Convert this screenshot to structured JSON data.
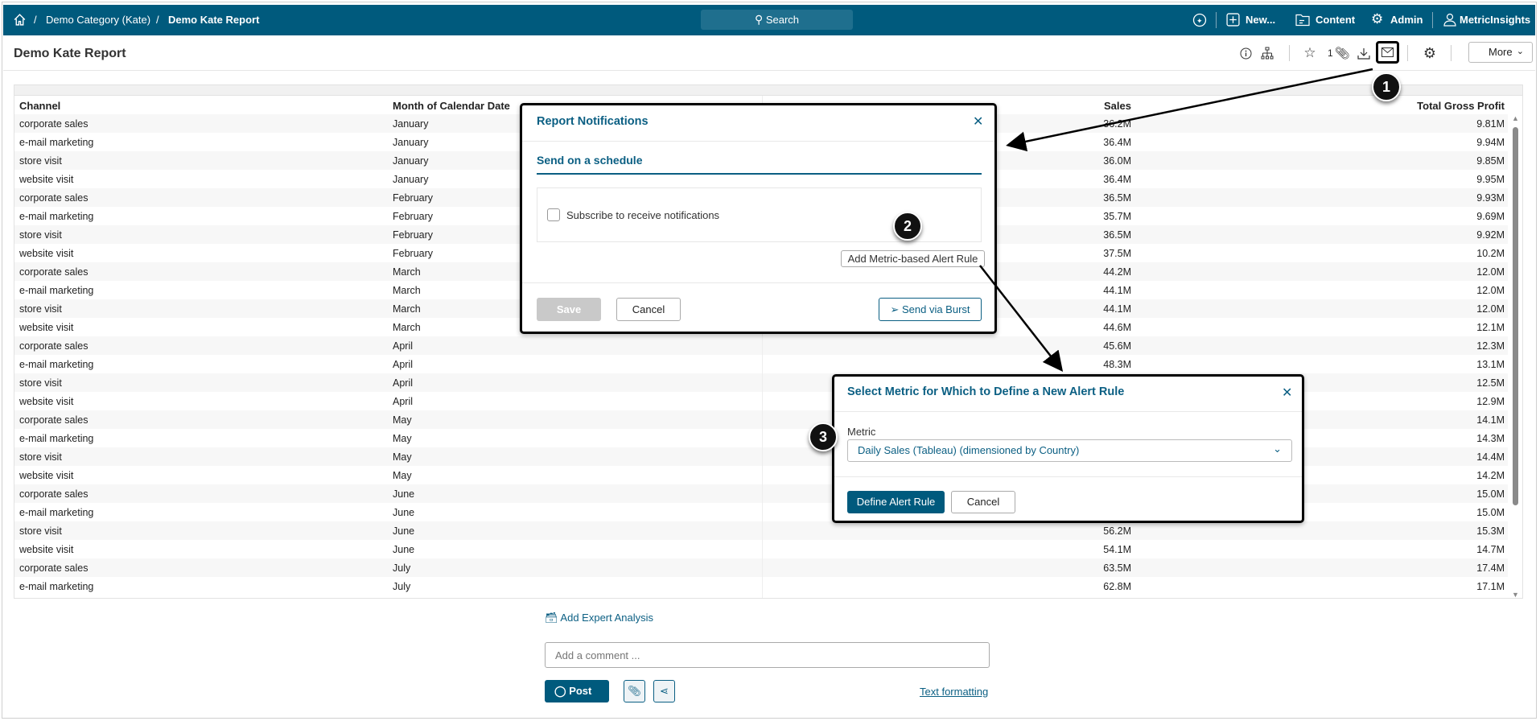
{
  "nav": {
    "breadcrumb": [
      "Demo Category (Kate)",
      "Demo Kate Report"
    ],
    "search_label": "Search",
    "new_label": "New...",
    "content_label": "Content",
    "admin_label": "Admin",
    "user_label": "MetricInsights"
  },
  "header": {
    "title": "Demo Kate Report",
    "favorites_count": "1",
    "more_label": "More"
  },
  "table": {
    "columns": [
      "Channel",
      "Month of Calendar Date",
      "Sales",
      "Total Gross Profit"
    ],
    "rows": [
      [
        "corporate sales",
        "January",
        "36.2M",
        "9.81M"
      ],
      [
        "e-mail marketing",
        "January",
        "36.4M",
        "9.94M"
      ],
      [
        "store visit",
        "January",
        "36.0M",
        "9.85M"
      ],
      [
        "website visit",
        "January",
        "36.4M",
        "9.95M"
      ],
      [
        "corporate sales",
        "February",
        "36.5M",
        "9.93M"
      ],
      [
        "e-mail marketing",
        "February",
        "35.7M",
        "9.69M"
      ],
      [
        "store visit",
        "February",
        "36.5M",
        "9.92M"
      ],
      [
        "website visit",
        "February",
        "37.5M",
        "10.2M"
      ],
      [
        "corporate sales",
        "March",
        "44.2M",
        "12.0M"
      ],
      [
        "e-mail marketing",
        "March",
        "44.1M",
        "12.0M"
      ],
      [
        "store visit",
        "March",
        "44.1M",
        "12.0M"
      ],
      [
        "website visit",
        "March",
        "44.6M",
        "12.1M"
      ],
      [
        "corporate sales",
        "April",
        "45.6M",
        "12.3M"
      ],
      [
        "e-mail marketing",
        "April",
        "48.3M",
        "13.1M"
      ],
      [
        "store visit",
        "April",
        null,
        "12.5M"
      ],
      [
        "website visit",
        "April",
        null,
        "12.9M"
      ],
      [
        "corporate sales",
        "May",
        null,
        "14.1M"
      ],
      [
        "e-mail marketing",
        "May",
        null,
        "14.3M"
      ],
      [
        "store visit",
        "May",
        null,
        "14.4M"
      ],
      [
        "website visit",
        "May",
        null,
        "14.2M"
      ],
      [
        "corporate sales",
        "June",
        null,
        "15.0M"
      ],
      [
        "e-mail marketing",
        "June",
        null,
        "15.0M"
      ],
      [
        "store visit",
        "June",
        "56.2M",
        "15.3M"
      ],
      [
        "website visit",
        "June",
        "54.1M",
        "14.7M"
      ],
      [
        "corporate sales",
        "July",
        "63.5M",
        "17.4M"
      ],
      [
        "e-mail marketing",
        "July",
        "62.8M",
        "17.1M"
      ]
    ]
  },
  "notifications_modal": {
    "title": "Report Notifications",
    "tab": "Send on a schedule",
    "subscribe_label": "Subscribe to receive notifications",
    "add_rule_label": "Add Metric-based Alert Rule",
    "save_label": "Save",
    "cancel_label": "Cancel",
    "burst_label": "Send via Burst"
  },
  "metric_modal": {
    "title": "Select Metric for Which to Define a New Alert Rule",
    "metric_label": "Metric",
    "metric_value": "Daily Sales (Tableau) (dimensioned by Country)",
    "define_label": "Define Alert Rule",
    "cancel_label": "Cancel"
  },
  "comments": {
    "expert_label": "Add Expert Analysis",
    "placeholder": "Add a comment ...",
    "post_label": "Post",
    "formatting_label": "Text formatting"
  },
  "markers": [
    "1",
    "2",
    "3"
  ],
  "colors": {
    "brand": "#005a7d",
    "accent": "#0b5f83"
  }
}
